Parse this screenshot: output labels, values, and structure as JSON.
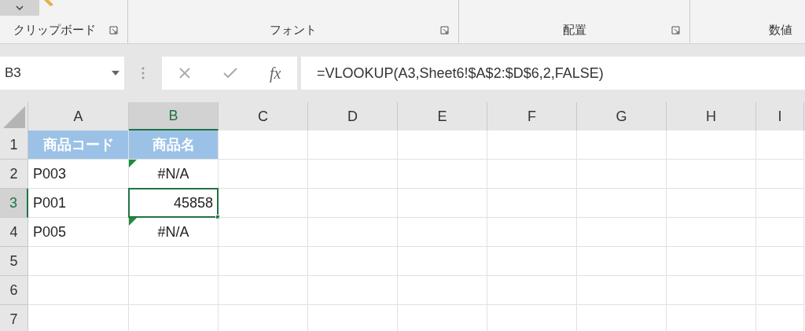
{
  "ribbon": {
    "groups": [
      {
        "label": "クリップボード",
        "launcher": true
      },
      {
        "label": "フォント",
        "launcher": true
      },
      {
        "label": "配置",
        "launcher": true
      },
      {
        "label": "数値",
        "launcher": false
      }
    ]
  },
  "formula_bar": {
    "name_box": "B3",
    "fx": "fx",
    "formula": "=VLOOKUP(A3,Sheet6!$A$2:$D$6,2,FALSE)"
  },
  "columns": [
    {
      "label": "A",
      "selected": false
    },
    {
      "label": "B",
      "selected": true
    },
    {
      "label": "C",
      "selected": false
    },
    {
      "label": "D",
      "selected": false
    },
    {
      "label": "E",
      "selected": false
    },
    {
      "label": "F",
      "selected": false
    },
    {
      "label": "G",
      "selected": false
    },
    {
      "label": "H",
      "selected": false
    },
    {
      "label": "I",
      "selected": false
    }
  ],
  "rows": [
    {
      "label": "1",
      "selected": false,
      "cells": [
        {
          "kind": "header",
          "text": "商品コード"
        },
        {
          "kind": "header",
          "text": "商品名"
        }
      ]
    },
    {
      "label": "2",
      "selected": false,
      "cells": [
        {
          "kind": "text",
          "text": "P003"
        },
        {
          "kind": "error",
          "text": "#N/A",
          "error_flag": true
        }
      ]
    },
    {
      "label": "3",
      "selected": true,
      "cells": [
        {
          "kind": "text",
          "text": "P001"
        },
        {
          "kind": "number",
          "text": "45858",
          "selected": true
        }
      ]
    },
    {
      "label": "4",
      "selected": false,
      "cells": [
        {
          "kind": "text",
          "text": "P005"
        },
        {
          "kind": "error",
          "text": "#N/A",
          "error_flag": true
        }
      ]
    },
    {
      "label": "5",
      "selected": false,
      "cells": []
    },
    {
      "label": "6",
      "selected": false,
      "cells": []
    },
    {
      "label": "7",
      "selected": false,
      "cells": []
    }
  ]
}
